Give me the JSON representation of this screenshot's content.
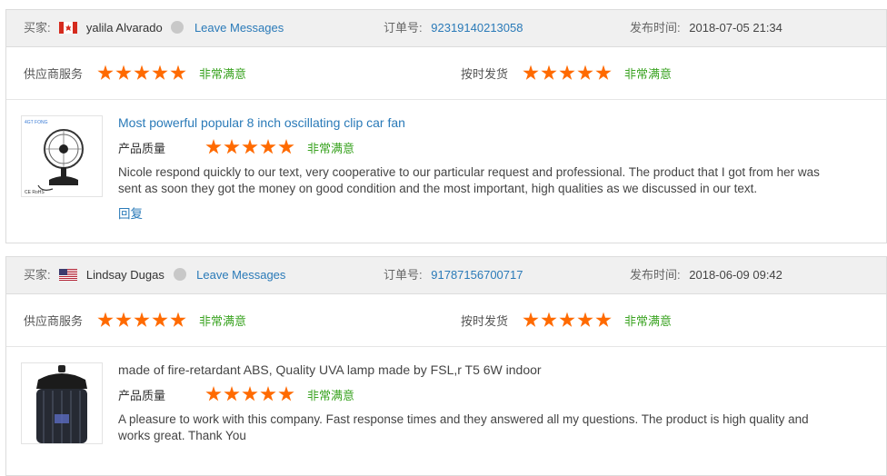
{
  "labels": {
    "buyer": "买家:",
    "leave_messages": "Leave Messages",
    "order_no": "订单号:",
    "publish_time": "发布时间:",
    "supplier_service": "供应商服务",
    "on_time_delivery": "按时发货",
    "very_satisfied": "非常满意",
    "product_quality": "产品质量",
    "reply": "回复"
  },
  "colors": {
    "star": "#ff6a00",
    "satisfied": "#3aa321",
    "link": "#2a7ab8"
  },
  "reviews": [
    {
      "buyer_name": "yalila Alvarado",
      "flag": "canada-flag-icon",
      "order_number": "92319140213058",
      "publish_time": "2018-07-05 21:34",
      "supplier_service_stars": 5,
      "on_time_delivery_stars": 5,
      "product_title": "Most powerful popular 8 inch oscillating clip car fan",
      "product_quality_stars": 5,
      "review_text": "Nicole respond quickly to our text, very cooperative to our particular request and professional. The product that I got from her was sent as soon they got the money on good condition and the most important, high qualities as we discussed in our text.",
      "thumbnail_text": {
        "brand": "4GT FONG",
        "marks": "CE RoHS"
      }
    },
    {
      "buyer_name": "Lindsay Dugas",
      "flag": "usa-flag-icon",
      "order_number": "91787156700717",
      "publish_time": "2018-06-09 09:42",
      "supplier_service_stars": 5,
      "on_time_delivery_stars": 5,
      "product_title": "made of fire-retardant ABS, Quality UVA lamp made by FSL,r T5 6W indoor",
      "product_quality_stars": 5,
      "review_text": "A pleasure to work with this company. Fast response times and they answered all my questions. The product is high quality and works great. Thank You"
    }
  ]
}
